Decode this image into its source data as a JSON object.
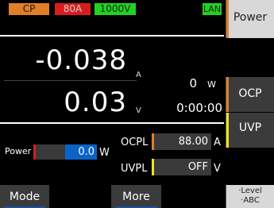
{
  "status": {
    "mode": "CP",
    "current_range": "80A",
    "voltage_range": "1000V",
    "lan": "LAN"
  },
  "measurement": {
    "current": "-0.038",
    "current_unit": "A",
    "voltage": "0.03",
    "voltage_unit": "V",
    "power": "0",
    "power_unit": "W",
    "elapsed_time": "0:00:00"
  },
  "settings": {
    "power_label": "Power",
    "power_value": "0.0",
    "power_unit": "W",
    "ocpl_label": "OCPL",
    "ocpl_value": "88.00",
    "ocpl_unit": "A",
    "uvpl_label": "UVPL",
    "uvpl_value": "OFF",
    "uvpl_unit": "V"
  },
  "softkeys": {
    "power": "Power",
    "ocp": "OCP",
    "uvp": "UVP",
    "level_line1": "·Level",
    "level_line2": "·ABC",
    "mode": "Mode",
    "more": "More"
  },
  "colors": {
    "mode_tag": "#e07f28",
    "current_tag": "#d71d1d",
    "voltage_tag": "#1fd31f",
    "lan_tag": "#1fd31f",
    "edit_highlight": "#0b63c7",
    "ocp_accent": "#e07f28",
    "uvp_accent": "#f2e024"
  }
}
